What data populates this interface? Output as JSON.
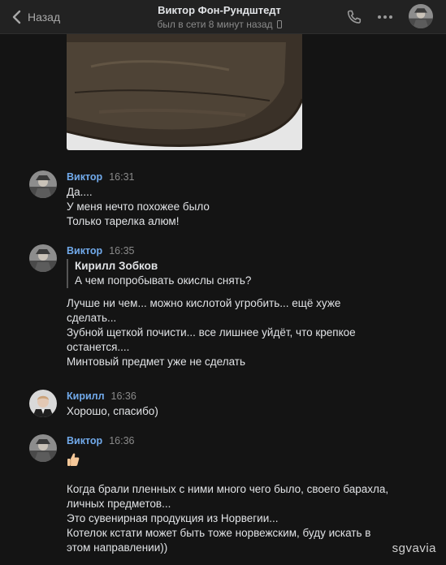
{
  "header": {
    "back_label": "Назад",
    "title": "Виктор Фон-Рундштедт",
    "status": "был в сети 8 минут назад",
    "call_icon": "phone-icon",
    "more_icon": "more-horizontal-icon",
    "status_icon": "mobile-phone-icon"
  },
  "messages": [
    {
      "author": "Виктор",
      "time": "16:31",
      "lines": [
        "Да....",
        "У меня нечто похожее было",
        "Только тарелка алюм!"
      ]
    },
    {
      "author": "Виктор",
      "time": "16:35",
      "quote": {
        "author": "Кирилл Зобков",
        "text": "А чем попробывать окислы снять?"
      },
      "lines": [
        "Лучше ни чем... можно кислотой угробить... ещё хуже",
        "сделать...",
        "Зубной щеткой почисти... все лишнее уйдёт, что крепкое",
        "останется....",
        "Минтовый предмет уже не сделать"
      ]
    },
    {
      "author": "Кирилл",
      "time": "16:36",
      "lines": [
        "Хорошо, спасибо)"
      ]
    },
    {
      "author": "Виктор",
      "time": "16:36",
      "emoji": "thumbs-up-icon",
      "lines": [
        "Когда брали пленных с ними много чего было, своего барахла,",
        "личных предметов...",
        "Это сувенирная продукция из Норвегии...",
        "Котелок кстати может быть тоже норвежским, буду искать в",
        "этом направлении))"
      ]
    }
  ],
  "watermark": "sgvavia",
  "colors": {
    "background": "#141414",
    "header": "#222222",
    "author": "#71aaeb",
    "text": "#e1e3e6",
    "muted": "#8a8a8a"
  }
}
